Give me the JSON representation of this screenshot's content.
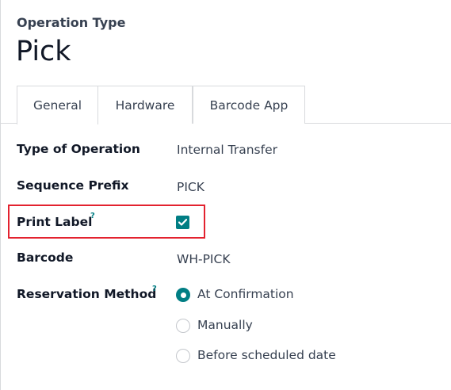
{
  "header": {
    "subtitle": "Operation Type",
    "title": "Pick"
  },
  "tabs": [
    {
      "label": "General",
      "active": true
    },
    {
      "label": "Hardware",
      "active": false
    },
    {
      "label": "Barcode App",
      "active": false
    }
  ],
  "fields": {
    "type_of_operation": {
      "label": "Type of Operation",
      "value": "Internal Transfer"
    },
    "sequence_prefix": {
      "label": "Sequence Prefix",
      "value": "PICK"
    },
    "print_label": {
      "label": "Print Label",
      "help": "?",
      "checked": true
    },
    "barcode": {
      "label": "Barcode",
      "value": "WH-PICK"
    },
    "reservation_method": {
      "label": "Reservation Method",
      "help": "?",
      "options": [
        {
          "label": "At Confirmation",
          "selected": true
        },
        {
          "label": "Manually",
          "selected": false
        },
        {
          "label": "Before scheduled date",
          "selected": false
        }
      ]
    }
  },
  "colors": {
    "accent": "#017e84",
    "highlight": "#e3222f",
    "border": "#d8dadd"
  },
  "icons": {
    "checkbox": "check-icon"
  }
}
